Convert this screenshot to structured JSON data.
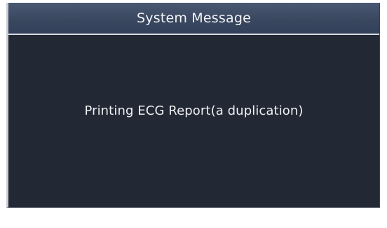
{
  "dialog": {
    "title": "System Message",
    "message": "Printing ECG Report(a duplication)"
  },
  "colors": {
    "titlebar": "#3e4a63",
    "body": "#222834",
    "text": "#eef0f3"
  }
}
